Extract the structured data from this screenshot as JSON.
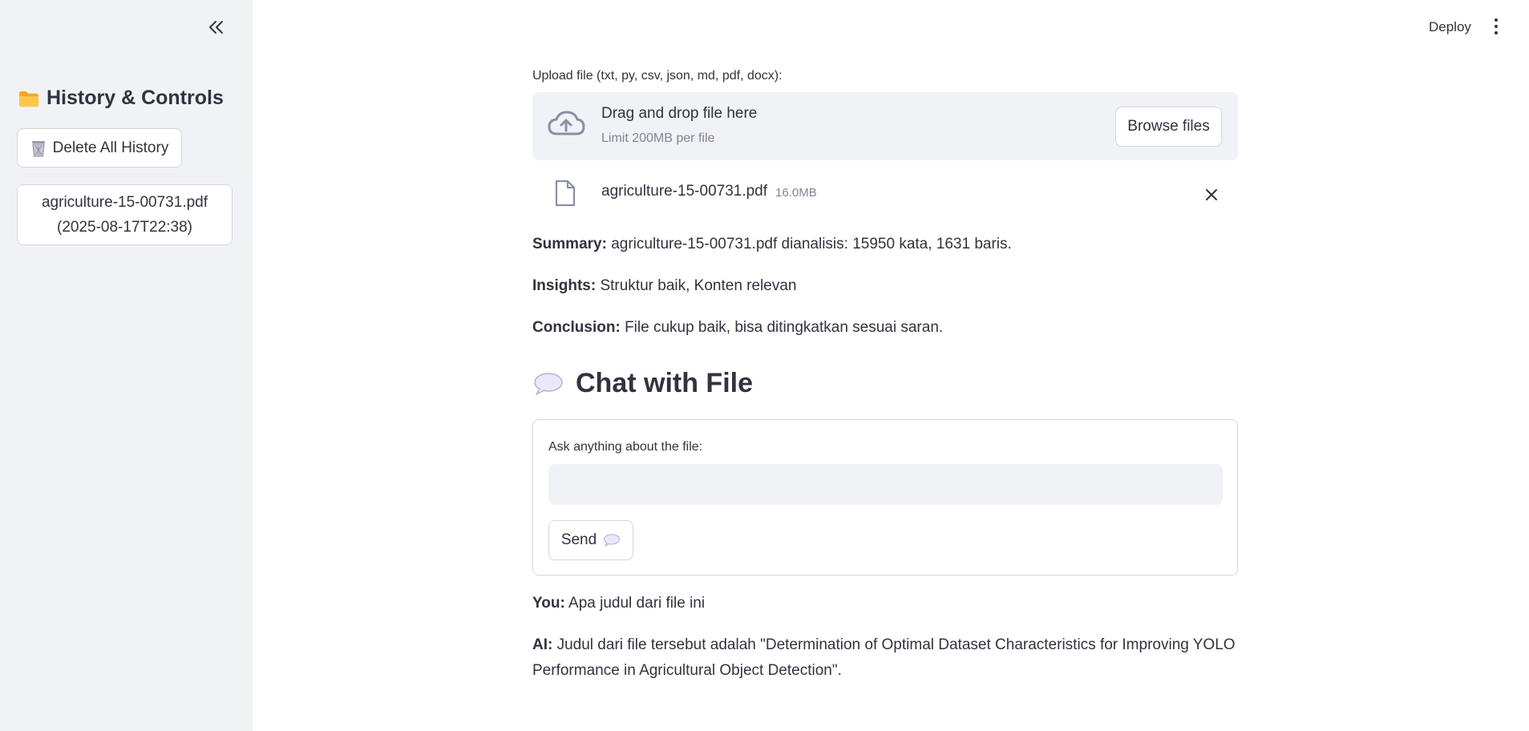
{
  "sidebar": {
    "title": "History & Controls",
    "delete_label": "Delete All History",
    "history": [
      {
        "line1": "agriculture-15-00731.pdf",
        "line2": "(2025-08-17T22:38)"
      }
    ]
  },
  "header": {
    "deploy_label": "Deploy"
  },
  "upload": {
    "label": "Upload file (txt, py, csv, json, md, pdf, docx):",
    "drop_title": "Drag and drop file here",
    "drop_sub": "Limit 200MB per file",
    "browse_label": "Browse files",
    "file_name": "agriculture-15-00731.pdf",
    "file_size": "16.0MB"
  },
  "analysis": {
    "summary_label": "Summary:",
    "summary_text": "agriculture-15-00731.pdf dianalisis: 15950 kata, 1631 baris.",
    "insights_label": "Insights:",
    "insights_text": "Struktur baik, Konten relevan",
    "conclusion_label": "Conclusion:",
    "conclusion_text": "File cukup baik, bisa ditingkatkan sesuai saran."
  },
  "chat": {
    "heading": "Chat with File",
    "ask_label": "Ask anything about the file:",
    "input_value": "",
    "send_label": "Send",
    "messages": [
      {
        "role_label": "You:",
        "text": "Apa judul dari file ini"
      },
      {
        "role_label": "AI:",
        "text": "Judul dari file tersebut adalah \"Determination of Optimal Dataset Characteristics for Improving YOLO Performance in Agricultural Object Detection\"."
      }
    ]
  },
  "colors": {
    "sidebar_bg": "#f0f2f6",
    "text": "#31333f",
    "muted": "#808495",
    "border": "#d6d6d9"
  }
}
